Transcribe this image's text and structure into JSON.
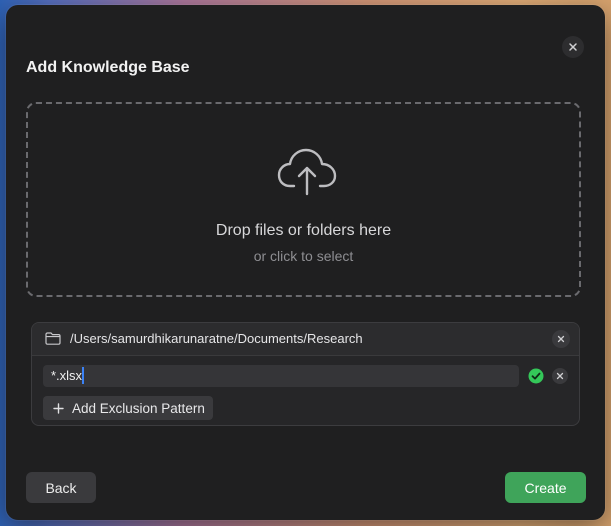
{
  "dialog": {
    "title": "Add Knowledge Base",
    "close_icon": "close-icon"
  },
  "dropzone": {
    "icon": "cloud-upload-icon",
    "primary_text": "Drop files or folders here",
    "secondary_text": "or click to select"
  },
  "folder": {
    "icon": "folder-icon",
    "path": "/Users/samurdhikarunaratne/Documents/Research",
    "remove_icon": "close-icon"
  },
  "exclusion": {
    "pattern_value": "*.xlsx",
    "confirm_icon": "checkmark-circle-icon",
    "remove_icon": "close-icon",
    "add_label": "Add Exclusion Pattern",
    "add_icon": "plus-icon"
  },
  "footer": {
    "back_label": "Back",
    "create_label": "Create"
  },
  "colors": {
    "dialog_bg": "#1f1f20",
    "accent_green": "#3fa45a",
    "check_green": "#34c759"
  }
}
